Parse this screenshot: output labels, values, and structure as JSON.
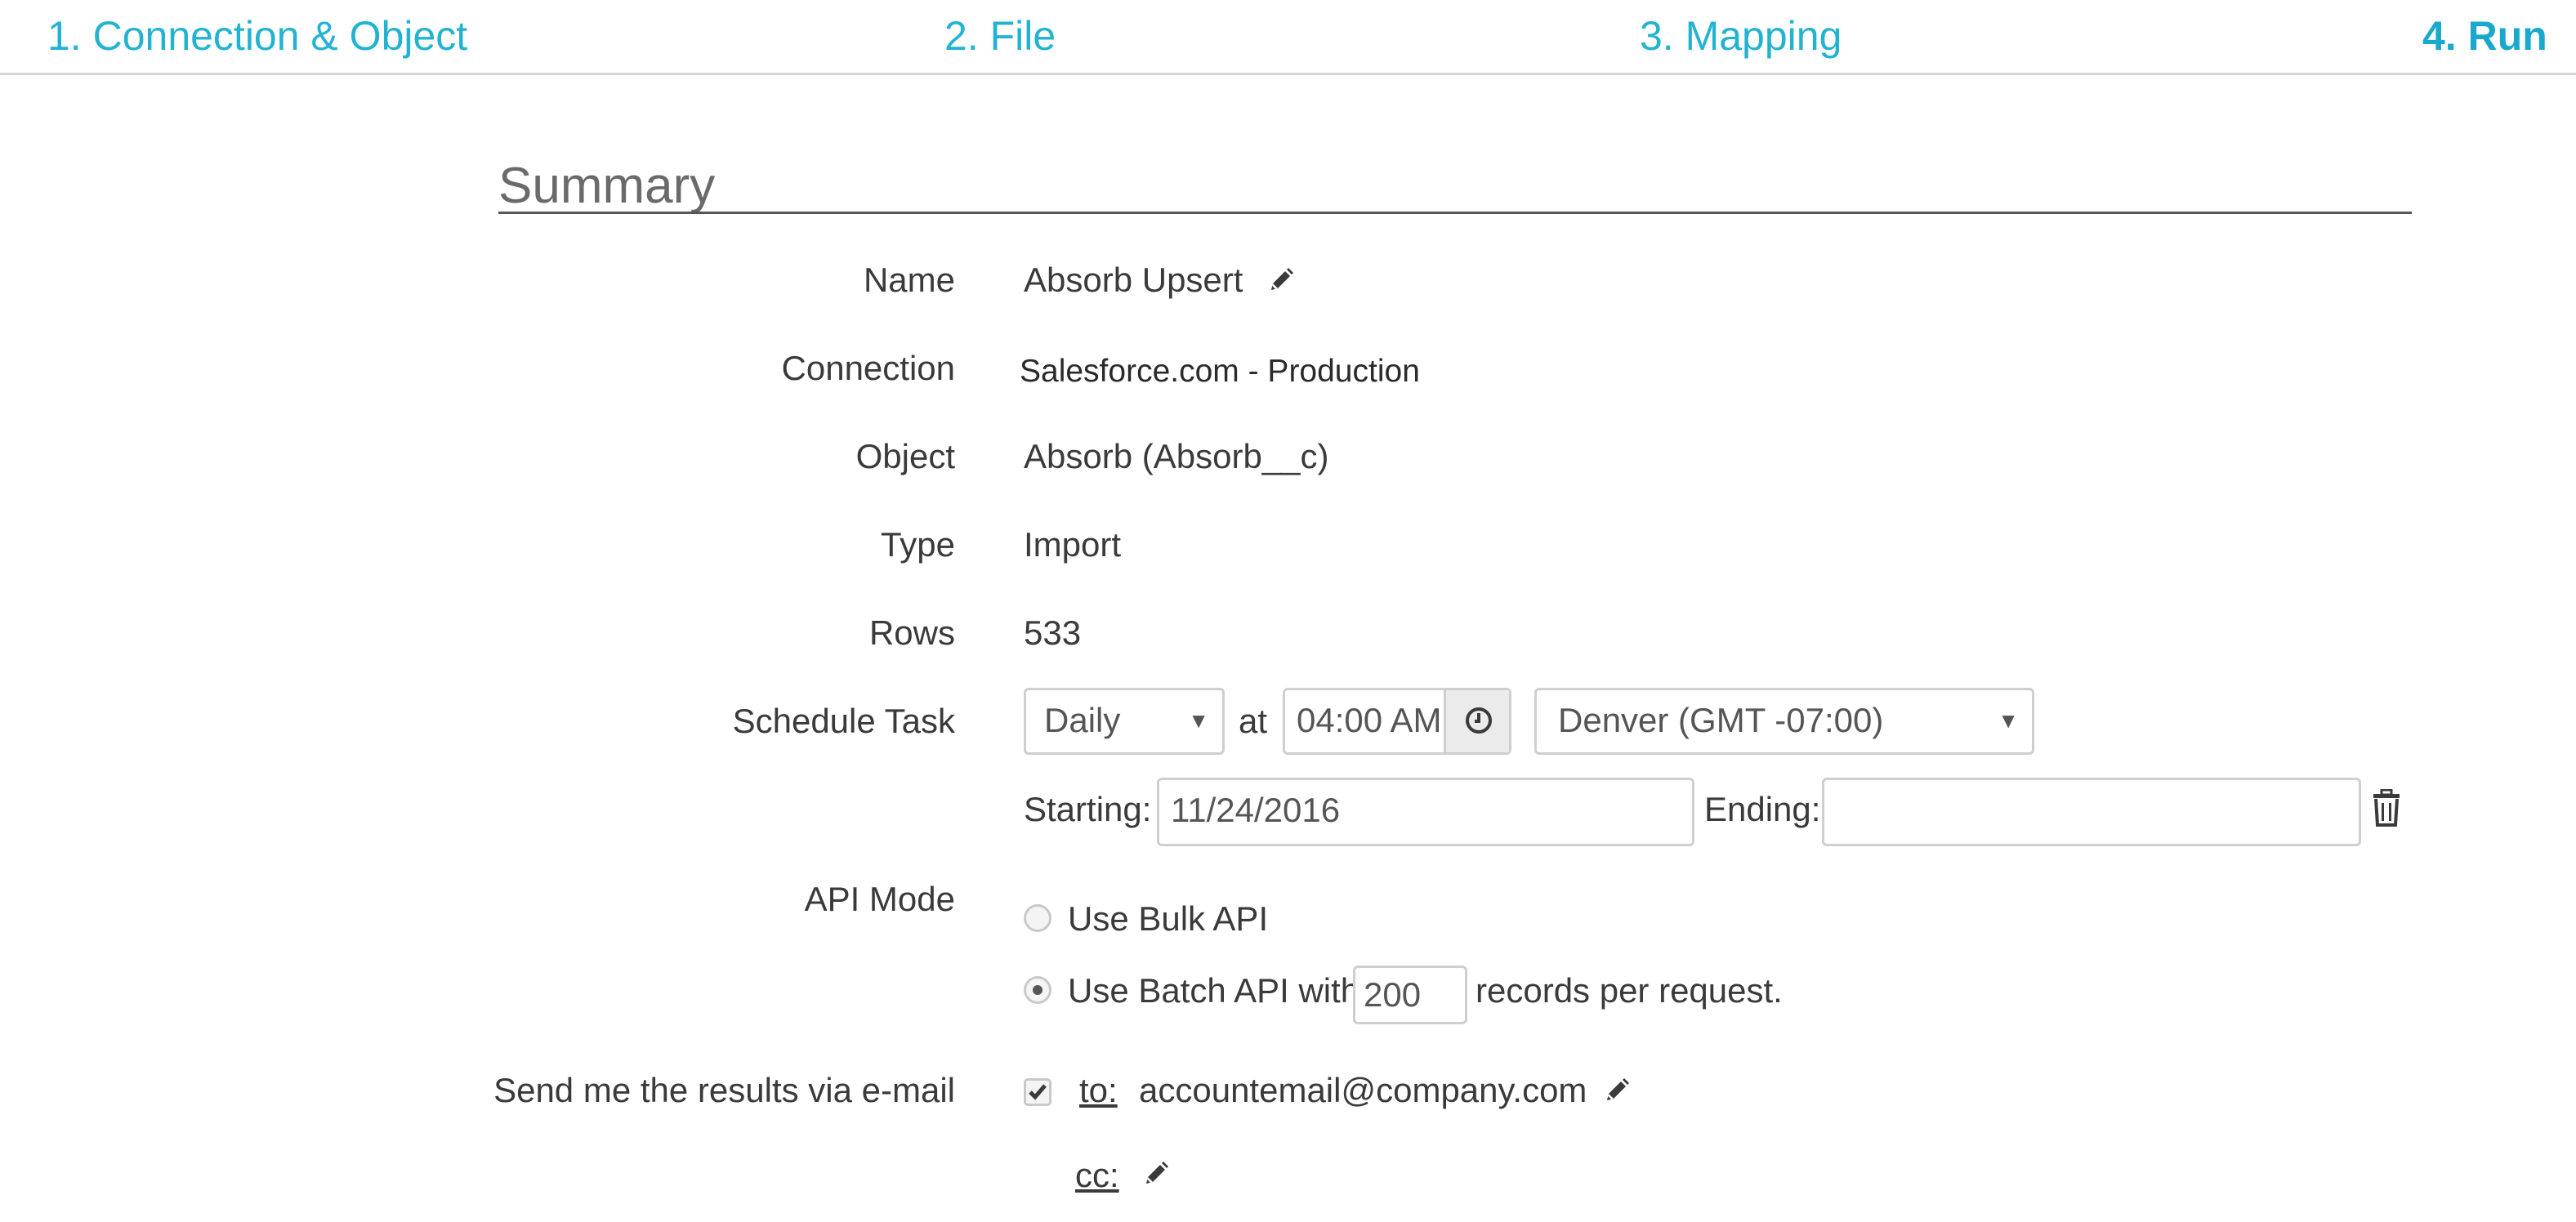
{
  "steps": [
    {
      "label": "1. Connection & Object"
    },
    {
      "label": "2. File"
    },
    {
      "label": "3. Mapping"
    },
    {
      "label": "4. Run"
    }
  ],
  "summary": {
    "title": "Summary",
    "name_label": "Name",
    "name_value": "Absorb Upsert",
    "connection_label": "Connection",
    "connection_value": "Salesforce.com - Production",
    "object_label": "Object",
    "object_value": "Absorb (Absorb__c)",
    "type_label": "Type",
    "type_value": "Import",
    "rows_label": "Rows",
    "rows_value": "533"
  },
  "schedule": {
    "label": "Schedule Task",
    "frequency": "Daily",
    "at_label": "at",
    "time": "04:00 AM",
    "timezone": "Denver (GMT -07:00)",
    "starting_label": "Starting:",
    "starting_value": "11/24/2016",
    "ending_label": "Ending:",
    "ending_value": ""
  },
  "api_mode": {
    "label": "API Mode",
    "bulk_label": "Use Bulk API",
    "batch_label": "Use Batch API with",
    "batch_size": "200",
    "batch_suffix": "records per request.",
    "selected": "batch"
  },
  "email": {
    "label": "Send me the results via e-mail",
    "checked": true,
    "to_label": "to:",
    "to_value": "accountemail@company.com",
    "cc_label": "cc:"
  },
  "colors": {
    "accent": "#22b3d3"
  },
  "icons": [
    "pencil-icon",
    "clock-icon",
    "trash-icon",
    "checkmark-icon",
    "caret-down-icon"
  ]
}
